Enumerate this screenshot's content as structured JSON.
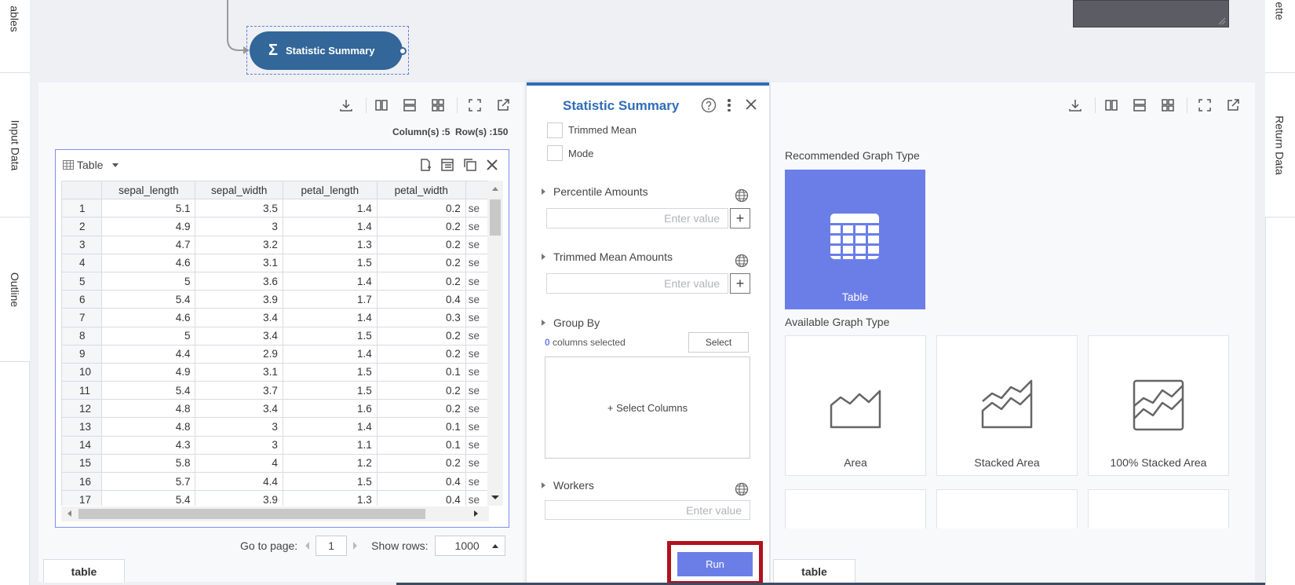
{
  "left_tabs": {
    "top": "ables",
    "input_data": "Input Data",
    "outline": "Outline"
  },
  "right_tabs": {
    "top": "ette",
    "return_data": "Return Data"
  },
  "node": {
    "label": "Statistic Summary"
  },
  "left_panel": {
    "columns_label": "Column(s) :5",
    "rows_label": "Row(s) :150",
    "view_select": "Table",
    "table": {
      "headers": [
        "",
        "sepal_length",
        "sepal_width",
        "petal_length",
        "petal_width",
        ""
      ],
      "rows": [
        [
          "1",
          "5.1",
          "3.5",
          "1.4",
          "0.2",
          "se"
        ],
        [
          "2",
          "4.9",
          "3",
          "1.4",
          "0.2",
          "se"
        ],
        [
          "3",
          "4.7",
          "3.2",
          "1.3",
          "0.2",
          "se"
        ],
        [
          "4",
          "4.6",
          "3.1",
          "1.5",
          "0.2",
          "se"
        ],
        [
          "5",
          "5",
          "3.6",
          "1.4",
          "0.2",
          "se"
        ],
        [
          "6",
          "5.4",
          "3.9",
          "1.7",
          "0.4",
          "se"
        ],
        [
          "7",
          "4.6",
          "3.4",
          "1.4",
          "0.3",
          "se"
        ],
        [
          "8",
          "5",
          "3.4",
          "1.5",
          "0.2",
          "se"
        ],
        [
          "9",
          "4.4",
          "2.9",
          "1.4",
          "0.2",
          "se"
        ],
        [
          "10",
          "4.9",
          "3.1",
          "1.5",
          "0.1",
          "se"
        ],
        [
          "11",
          "5.4",
          "3.7",
          "1.5",
          "0.2",
          "se"
        ],
        [
          "12",
          "4.8",
          "3.4",
          "1.6",
          "0.2",
          "se"
        ],
        [
          "13",
          "4.8",
          "3",
          "1.4",
          "0.1",
          "se"
        ],
        [
          "14",
          "4.3",
          "3",
          "1.1",
          "0.1",
          "se"
        ],
        [
          "15",
          "5.8",
          "4",
          "1.2",
          "0.2",
          "se"
        ],
        [
          "16",
          "5.7",
          "4.4",
          "1.5",
          "0.4",
          "se"
        ],
        [
          "17",
          "5.4",
          "3.9",
          "1.3",
          "0.4",
          "se"
        ]
      ]
    },
    "pager": {
      "goto_label": "Go to page:",
      "page": "1",
      "show_rows_label": "Show rows:",
      "rows_value": "1000"
    },
    "bottom_tab": "table"
  },
  "dialog": {
    "title": "Statistic Summary",
    "trimmed_mean": "Trimmed Mean",
    "mode": "Mode",
    "percentile_amounts": "Percentile Amounts",
    "trimmed_mean_amounts": "Trimmed Mean Amounts",
    "placeholder": "Enter value",
    "group_by": "Group By",
    "selected_count": "0",
    "columns_selected": "columns selected",
    "select_button": "Select",
    "select_columns": "+ Select Columns",
    "workers": "Workers",
    "run_button": "Run"
  },
  "right_panel": {
    "recommended_label": "Recommended Graph Type",
    "recommended_card": "Table",
    "available_label": "Available Graph Type",
    "cards": [
      "Area",
      "Stacked Area",
      "100% Stacked Area"
    ],
    "bottom_tab": "table"
  },
  "colors": {
    "accent": "#6b7ee8",
    "node": "#336699",
    "run_highlight": "#b0121b"
  }
}
